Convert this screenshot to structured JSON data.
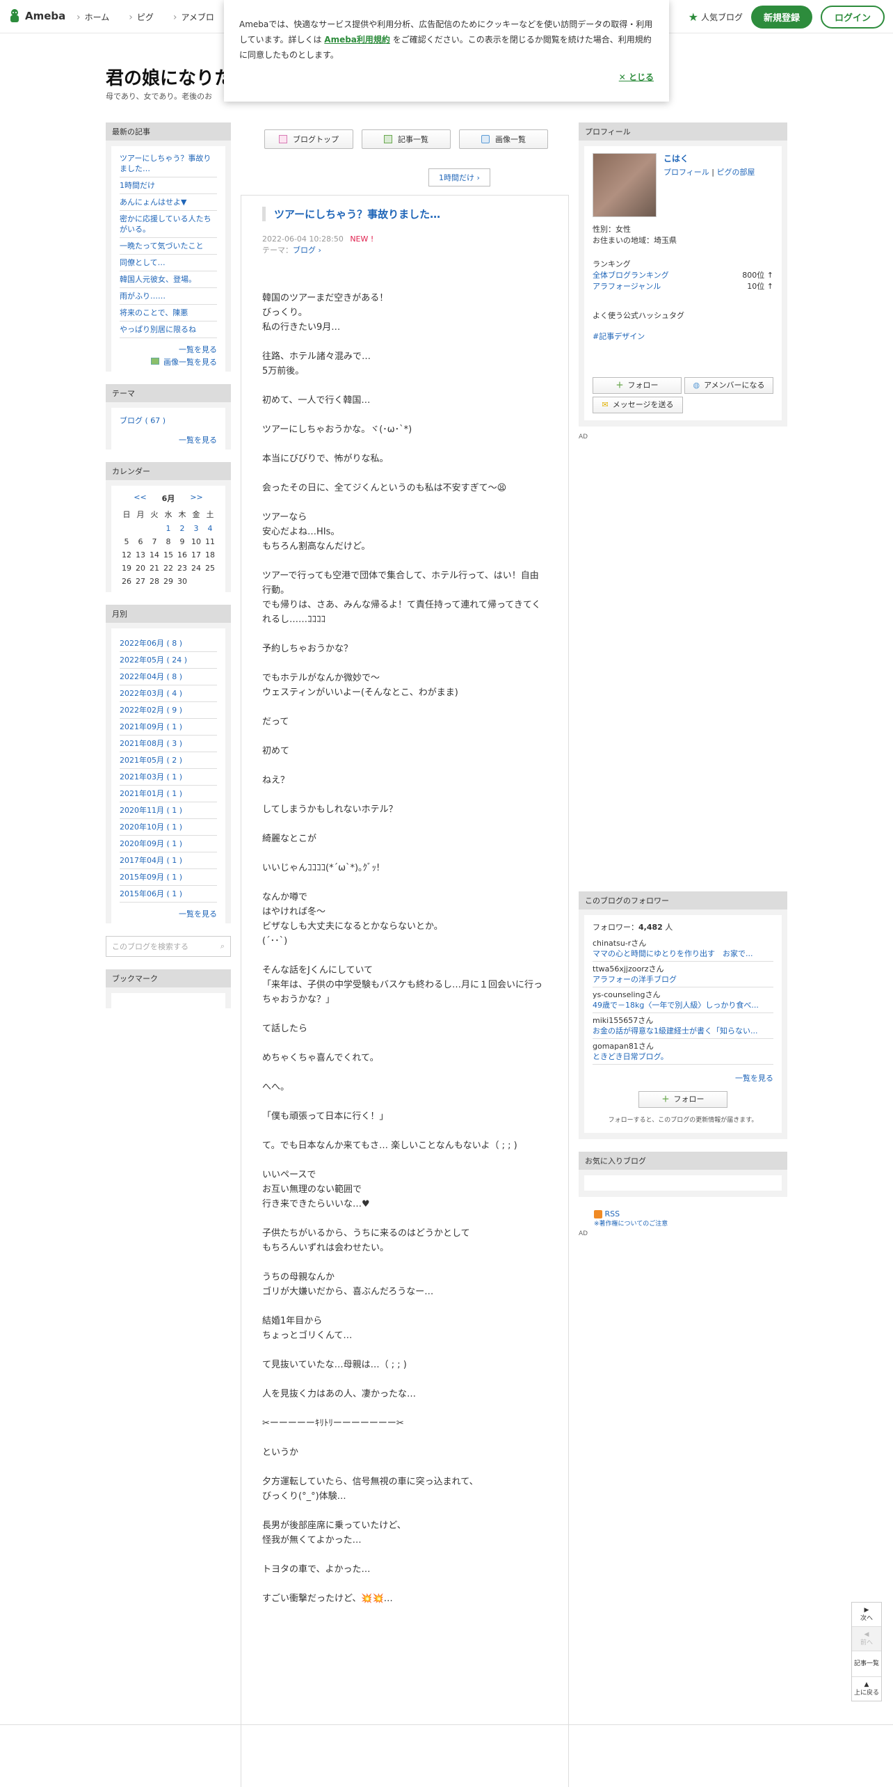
{
  "header": {
    "logo_text": "Ameba",
    "nav": [
      "ホーム",
      "ピグ",
      "アメブロ"
    ],
    "popular_label": "人気ブログ",
    "register_label": "新規登録",
    "login_label": "ログイン"
  },
  "cookie": {
    "text_before": "Amebaでは、快適なサービス提供や利用分析、広告配信のためにクッキーなどを使い訪問データの取得・利用しています。詳しくは",
    "link": "Ameba利用規約",
    "text_after": "をご確認ください。この表示を閉じるか閲覧を続けた場合、利用規約に同意したものとします。",
    "close_label": "とじる"
  },
  "blog": {
    "title": "君の娘になりた",
    "description": "母であり、女であり。老後のお"
  },
  "left": {
    "recent_heading": "最新の記事",
    "recent_items": [
      "ツアーにしちゃう？事故りました…",
      "1時間だけ",
      "あんにょんはせよ▼",
      "密かに応援している人たちがいる。",
      "一晩たって気づいたこと",
      "同僚として…",
      "韓国人元彼女、登場。",
      "雨がふり……",
      "将来のことで、陳悪",
      "やっぱり別居に限るね"
    ],
    "recent_more": "一覧を見る",
    "recent_images": "画像一覧を見る",
    "theme_heading": "テーマ",
    "theme_item": "ブログ ( 67 )",
    "theme_more": "一覧を見る",
    "calendar_heading": "カレンダー",
    "cal_prev": "<<",
    "cal_month": "6月",
    "cal_next": ">>",
    "cal_weekdays": [
      "日",
      "月",
      "火",
      "水",
      "木",
      "金",
      "土"
    ],
    "cal_rows": [
      [
        "",
        "",
        "",
        "1",
        "2",
        "3",
        "4"
      ],
      [
        "5",
        "6",
        "7",
        "8",
        "9",
        "10",
        "11"
      ],
      [
        "12",
        "13",
        "14",
        "15",
        "16",
        "17",
        "18"
      ],
      [
        "19",
        "20",
        "21",
        "22",
        "23",
        "24",
        "25"
      ],
      [
        "26",
        "27",
        "28",
        "29",
        "30",
        "",
        ""
      ]
    ],
    "cal_links": [
      "1",
      "2",
      "3",
      "4"
    ],
    "monthly_heading": "月別",
    "monthly_items": [
      "2022年06月 ( 8 )",
      "2022年05月 ( 24 )",
      "2022年04月 ( 8 )",
      "2022年03月 ( 4 )",
      "2022年02月 ( 9 )",
      "2021年09月 ( 1 )",
      "2021年08月 ( 3 )",
      "2021年05月 ( 2 )",
      "2021年03月 ( 1 )",
      "2021年01月 ( 1 )",
      "2020年11月 ( 1 )",
      "2020年10月 ( 1 )",
      "2020年09月 ( 1 )",
      "2017年04月 ( 1 )",
      "2015年09月 ( 1 )",
      "2015年06月 ( 1 )"
    ],
    "monthly_more": "一覧を見る",
    "search_placeholder": "このブログを検索する",
    "bookmark_heading": "ブックマーク"
  },
  "main": {
    "tabs": [
      "ブログトップ",
      "記事一覧",
      "画像一覧"
    ],
    "pager_label": "1時間だけ",
    "entry_title": "ツアーにしちゃう？事故りました…",
    "entry_date": "2022-06-04 10:28:50",
    "entry_new": "NEW !",
    "entry_theme_label": "テーマ：",
    "entry_theme": "ブログ",
    "paragraphs": [
      "韓国のツアーまだ空きがある！\nびっくり。\n私の行きたい9月…",
      "往路、ホテル諸々混みで…\n5万前後。",
      "初めて、一人で行く韓国…",
      "ツアーにしちゃおうかな。ヾ(･ω･`*)",
      "本当にびびりで、怖がりな私。",
      "会ったその日に、全てジくんというのも私は不安すぎて～😫",
      "ツアーなら\n安心だよね…HIs。\nもちろん割高なんだけど。",
      "ツアーで行っても空港で団体で集合して、ホテル行って、はい！自由行動。\nでも帰りは、さあ、みんな帰るよ！て責任持って連れて帰ってきてくれるし……ｺｺｺｺ",
      "予約しちゃおうかな？",
      "でもホテルがなんか微妙で～\nウェスティンがいいよー(そんなとこ、わがまま)",
      "だって",
      "初めて",
      "ねえ？",
      "してしまうかもしれないホテル？",
      "綺麗なとこが",
      "いいじゃんｺｺｺｺ(*´ω`*)｡ｸﾞｯ!",
      "なんか噂で\nはやければ冬～\nビザなしも大丈夫になるとかならないとか。\n(´･･`)",
      "そんな話をJくんにしていて\n「来年は、子供の中学受験もバスケも終わるし…月に１回会いに行っちゃおうかな？」",
      "て話したら",
      "めちゃくちゃ喜んでくれて。",
      "へへ。",
      "「僕も頑張って日本に行く！」",
      "て。でも日本なんか来てもさ… 楽しいことなんもないよ（ ; ; )",
      "いいペースで\nお互い無理のない範囲で\n行き来できたらいいな…♥",
      "子供たちがいるから、うちに来るのはどうかとして\nもちろんいずれは会わせたい。",
      "うちの母親なんか\nゴリが大嫌いだから、喜ぶんだろうなー…",
      "結婚1年目から\nちょっとゴリくんて…",
      "て見抜いていたな…母親は…（ ; ; )",
      "人を見抜く力はあの人、凄かったな…",
      "✂ーーーーーｷﾘﾄﾘーーーーーーー✂",
      "というか",
      "夕方運転していたら、信号無視の車に突っ込まれて、\nびっくり(°_°)体験…",
      "長男が後部座席に乗っていたけど、\n怪我が無くてよかった…",
      "トヨタの車で、よかった…",
      "すごい衝撃だったけど、💥💥…"
    ]
  },
  "right": {
    "profile_heading": "プロフィール",
    "profile_name": "こはく",
    "profile_link1": "プロフィール",
    "profile_link2": "ピグの部屋",
    "gender": "性別：女性",
    "residence": "お住まいの地域：埼玉県",
    "ranking_label": "ランキング",
    "rank1_label": "全体ブログランキング",
    "rank1_value": "800位 ↑",
    "rank2_label": "アラフォージャンル",
    "rank2_value": "10位 ↑",
    "hashtag_label": "よく使う公式ハッシュタグ",
    "hashtag": "#記事デザイン",
    "follow_label": "フォロー",
    "member_label": "アメンバーになる",
    "message_label": "メッセージを送る",
    "ad_label": "AD",
    "followers_heading": "このブログのフォロワー",
    "followers_count_label": "フォロワー：",
    "followers_count": "4,482",
    "followers_unit": "人",
    "followers": [
      {
        "user": "chinatsu-rさん",
        "blog": "ママの心と時間にゆとりを作り出す　お家で..."
      },
      {
        "user": "ttwa56xjjzoorzさん",
        "blog": "アラフォーの洋手ブログ"
      },
      {
        "user": "ys-counselingさん",
        "blog": "49歳で－18kg〈一年で別人級〉しっかり食べ..."
      },
      {
        "user": "miki155657さん",
        "blog": "お金の話が得意な1級建経士が書く「知らない..."
      },
      {
        "user": "gomapan81さん",
        "blog": "ときどき日常ブログ。"
      }
    ],
    "followers_more": "一覧を見る",
    "follow_btn2": "フォロー",
    "follow_note": "フォローすると、このブログの更新情報が届きます。",
    "favorites_heading": "お気に入りブログ",
    "rss_label": "RSS",
    "copyright_note": "※著作権についてのご注意",
    "ad_label2": "AD"
  },
  "side_nav": {
    "next": "次へ",
    "prev": "前へ",
    "list": "記事一覧",
    "top": "上に戻る"
  }
}
